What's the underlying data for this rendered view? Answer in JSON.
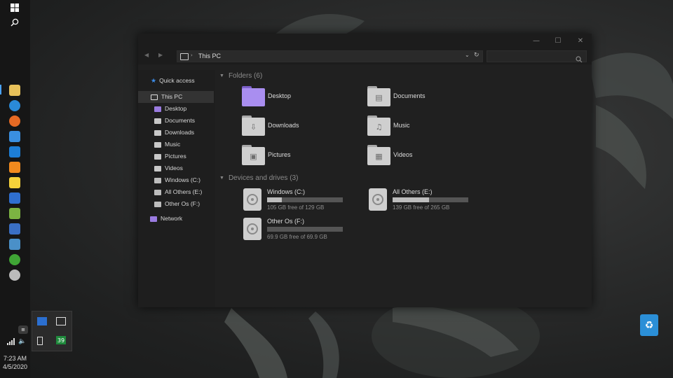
{
  "desktop": {
    "recycle_bin_icon": "recycle-bin-icon"
  },
  "taskbar": {
    "pinned_icons": [
      "file-explorer-icon",
      "edge-icon",
      "firefox-icon",
      "store-icon",
      "mail-icon",
      "sublime-icon",
      "sticky-notes-icon",
      "dev-tool-icon",
      "xampp-icon",
      "remote-desktop-icon",
      "control-panel-icon",
      "xbox-icon",
      "settings-icon"
    ],
    "tray": {
      "time": "7:23 AM",
      "date": "4/5/2020",
      "badge": "39"
    }
  },
  "window": {
    "breadcrumb": [
      "This PC"
    ],
    "nav": {
      "quick_access": "Quick access",
      "this_pc": "This PC",
      "items": [
        "Desktop",
        "Documents",
        "Downloads",
        "Music",
        "Pictures",
        "Videos",
        "Windows (C:)",
        "All Others (E:)",
        "Other Os (F:)"
      ],
      "network": "Network"
    },
    "folders_header": "Folders (6)",
    "folders": [
      "Desktop",
      "Documents",
      "Downloads",
      "Music",
      "Pictures",
      "Videos"
    ],
    "drives_header": "Devices and drives (3)",
    "drives": [
      {
        "name": "Windows (C:)",
        "free": "105 GB free of 129 GB",
        "used_fraction": 0.19
      },
      {
        "name": "All Others (E:)",
        "free": "139 GB free of 265 GB",
        "used_fraction": 0.48
      },
      {
        "name": "Other Os (F:)",
        "free": "69.9 GB free of 69.9 GB",
        "used_fraction": 0.0
      }
    ]
  }
}
